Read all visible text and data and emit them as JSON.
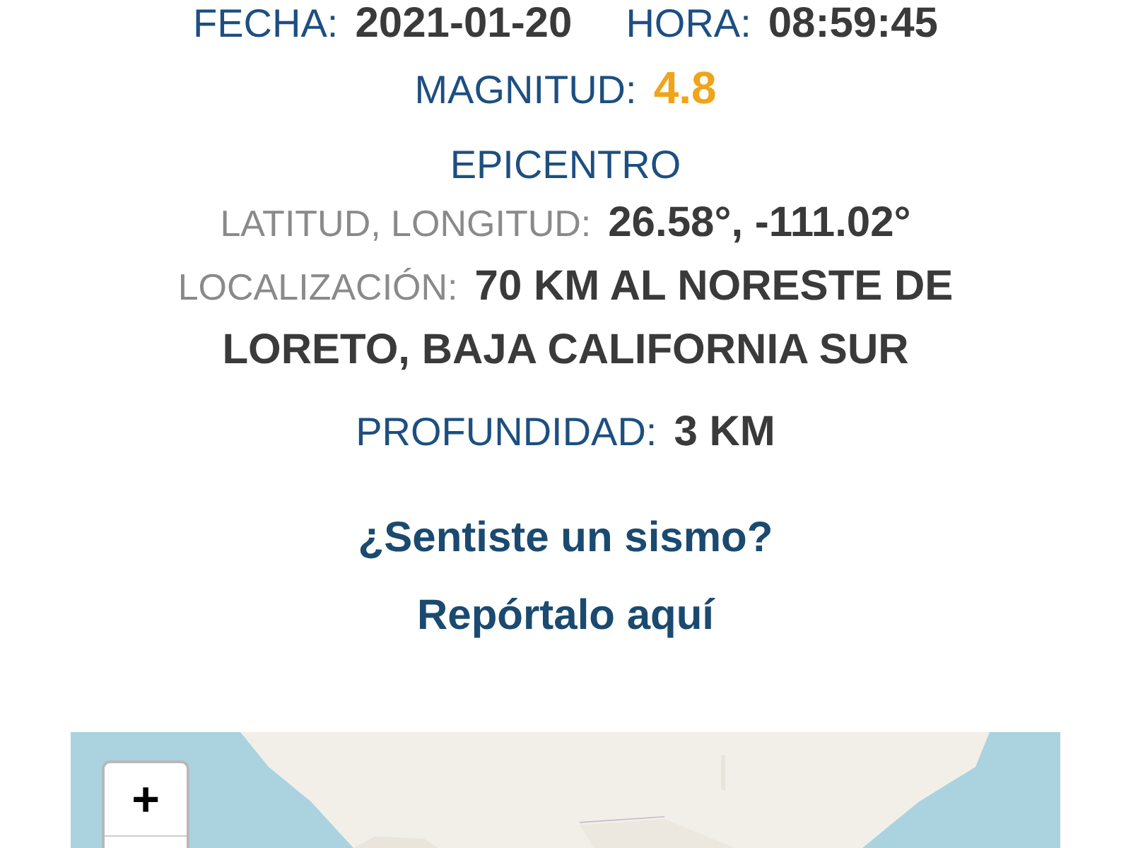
{
  "datetime": [
    {
      "label": "FECHA:",
      "value": "2021-01-20"
    },
    {
      "label": "HORA:",
      "value": "08:59:45"
    }
  ],
  "magnitude": {
    "label": "MAGNITUD:",
    "value": "4.8"
  },
  "epicenter": {
    "heading": "EPICENTRO",
    "fields": [
      {
        "label": "LATITUD, LONGITUD:",
        "value": "26.58°, -111.02°"
      },
      {
        "label": "LOCALIZACIÓN:",
        "value": "70 KM AL NORESTE DE LORETO, BAJA CALIFORNIA SUR"
      }
    ]
  },
  "depth": {
    "label": "PROFUNDIDAD:",
    "value": "3 KM"
  },
  "report_links": [
    "¿Sentiste un sismo?",
    "Repórtalo aquí"
  ],
  "map": {
    "kind": "picture",
    "zoom_in": "+"
  }
}
